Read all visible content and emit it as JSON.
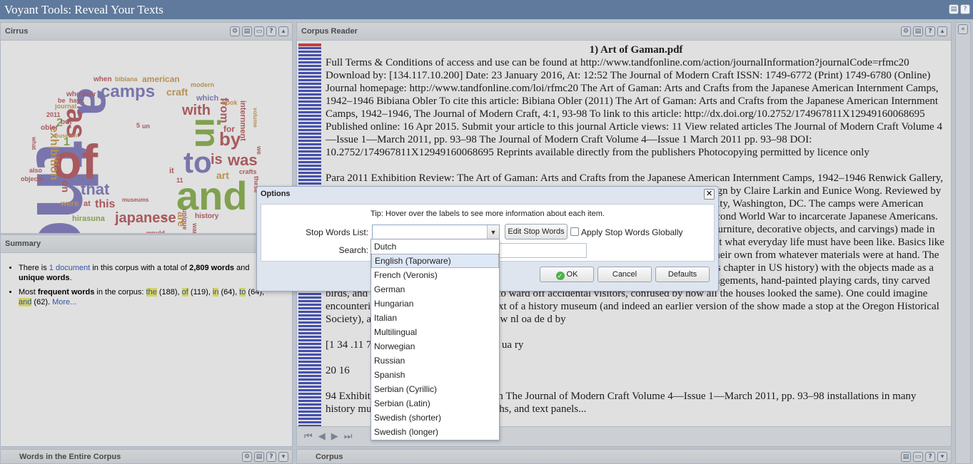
{
  "app": {
    "title": "Voyant Tools: Reveal Your Texts"
  },
  "cirrus": {
    "title": "Cirrus"
  },
  "summary": {
    "title": "Summary",
    "line1_a": "There is ",
    "line1_link": "1 document",
    "line1_b": " in this corpus with a total of ",
    "line1_words": "2,809 words",
    "line1_c": " and ",
    "line1_unique": "unique words",
    "line1_d": ".",
    "line2_a": "Most ",
    "line2_freq": "frequent words",
    "line2_b": " in the corpus: ",
    "w1": "the",
    "c1": " (188), ",
    "w2": "of",
    "c2": " (119), ",
    "w3": "in",
    "c3": " (64), ",
    "w4": "to",
    "c4": " (64),",
    "w5": "and",
    "c5": " (62). ",
    "more": "More..."
  },
  "words_panel": {
    "title": "Words in the Entire Corpus"
  },
  "reader": {
    "title": "Corpus Reader",
    "doc_title": "1) Art of Gaman.pdf",
    "p1": "Full Terms & Conditions of access and use can be found at http://www.tandfonline.com/action/journalInformation?journalCode=rfmc20 Download by: [134.117.10.200] Date: 23 January 2016, At: 12:52 The Journal of Modern Craft ISSN: 1749-6772 (Print) 1749-6780 (Online) Journal homepage: http://www.tandfonline.com/loi/rfmc20 The Art of Gaman: Arts and Crafts from the Japanese American Internment Camps, 1942–1946 Bibiana Obler To cite this article: Bibiana Obler (2011) The Art of Gaman: Arts and Crafts from the Japanese American Internment Camps, 1942–1946, The Journal of Modern Craft, 4:1, 93-98 To link to this article: http://dx.doi.org/10.2752/174967811X12949160068695 Published online: 16 Apr 2015. Submit your article to this journal Article views: 11 View related articles The Journal of Modern Craft Volume 4—Issue 1—March 2011, pp. 93–98 The Journal of Modern Craft Volume 4—Issue 1 March 2011 pp. 93–98 DOI: 10.2752/174967811X12949160068695 Reprints available directly from the publishers Photocopying permitted by licence only",
    "p2": "Para 2011 Exhibition Review: The Art of Gaman: Arts and Crafts from the Japanese American Internment Camps, 1942–1946 Renwick Gallery, Smithsonian American Art Museum, Washington, DC. Curated by Delphine Hirasuna. Design by Claire Larkin and Eunice Wong. Reviewed by Bibiana Obler, Assistant Professor, Department of Art History, George Washington University, Washington, DC. The camps were American concentration camps in the interior of the West, set up by the US government during the Second World War to incarcerate Japanese Americans. The exhibition features works in a variety of media (oil paintings and watercolors but also furniture, decorative objects, and carvings) made in the camps, which nestled in grimly beautiful mountainous desert terrain. Visitors learn about what everyday life must have been like. Basics like chairs, tables, cabinets, and decorative objects were not supplied, so the internees devised their own from whatever materials were at hand. The word gaman means to endure; the title and the exhibition terms are rife when discussing this chapter in US history) with the objects made as a means of transforming their bleak surroundings into homes—with pipe-cleaner flower arrangements, hand-painted playing cards, tiny carved birds, and carved nameplates for doors (to ward off accidental visitors, confused by how all the houses looked the same). One could imagine encountering this exhibition in the context of a history museum (and indeed an earlier version of the show made a stop at the Oregon Historical Society), and it is not entirely unlike D ow nl oa de d by",
    "p3": "[1 34 .11 7. 10 .2 00 ] a t 1 2: 52 2 3 J an ua ry",
    "p4": "20 16",
    "p5": "94 Exhibition Review: The Art of Gaman The Journal of Modern Craft Volume 4—Issue 1—March 2011, pp. 93–98 installations in many history museums, with labels, photographs, and text panels..."
  },
  "corpus_panel": {
    "title": "Corpus"
  },
  "options": {
    "title": "Options",
    "tip": "Tip: Hover over the labels to see more information about each item.",
    "stop_label": "Stop Words List:",
    "stop_value": "",
    "search_label": "Search:",
    "search_value": "",
    "edit_btn": "Edit Stop Words",
    "apply_global": "Apply Stop Words Globally",
    "ok": "OK",
    "cancel": "Cancel",
    "defaults": "Defaults",
    "lists": [
      "Dutch",
      "English (Taporware)",
      "French (Veronis)",
      "German",
      "Hungarian",
      "Italian",
      "Multilingual",
      "Norwegian",
      "Russian",
      "Spanish",
      "Serbian (Cyrillic)",
      "Serbian (Latin)",
      "Swedish (shorter)",
      "Swedish (longer)"
    ],
    "highlighted": "English (Taporware)"
  },
  "cloud_words": [
    "the",
    "of",
    "a",
    "in",
    "and",
    "to",
    "as",
    "camps",
    "was",
    "that",
    "japanese",
    "by",
    "with",
    "is",
    "an",
    "exhibition",
    "on",
    "this",
    "are",
    "from",
    "art",
    "for",
    "were",
    "at",
    "craft",
    "it",
    "1",
    "2",
    "american",
    "hirasuna",
    "history",
    "bibiana",
    "when",
    "who",
    "their",
    "modern",
    "which",
    "book",
    "internment",
    "volume",
    "journal",
    "obler",
    "be",
    "have",
    "2011",
    "but",
    "museum",
    "5",
    "un",
    "what",
    "also",
    "objects",
    "we",
    "crafts",
    "these",
    "11",
    "would",
    "war",
    "unique",
    "museums",
    "te"
  ],
  "colors": {
    "topbar": "#5f7a9c",
    "cloud_purple": "#8a86c4",
    "cloud_red": "#c0676b",
    "cloud_green": "#92b85a",
    "cloud_orange": "#d1a560",
    "bar_blue": "#4f5cc7"
  }
}
